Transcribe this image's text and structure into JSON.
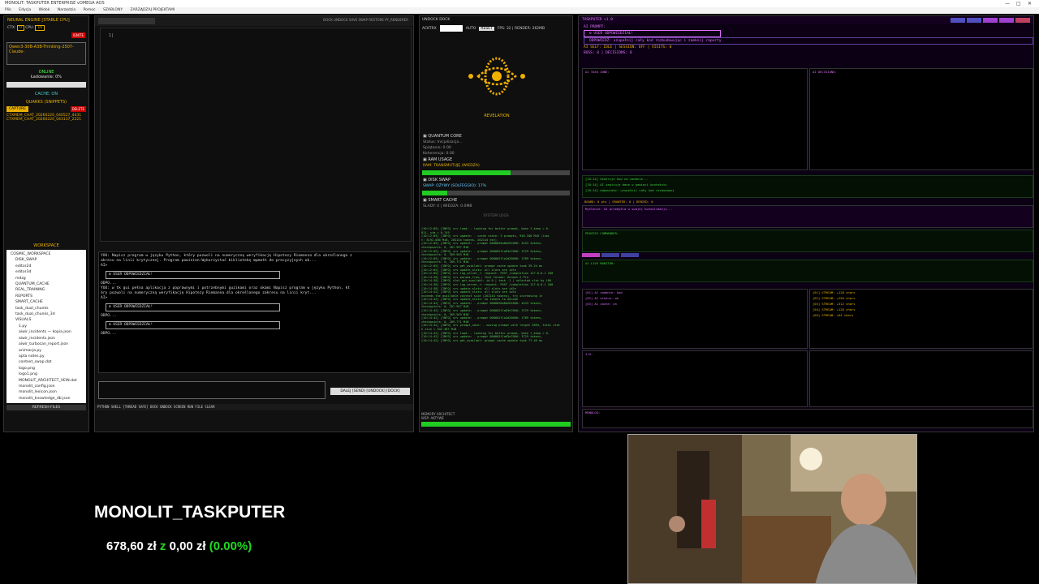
{
  "titlebar": {
    "title": "MONOLIT: TASKPUTER ENTERPRISE vOMEGA AOS"
  },
  "menubar": [
    "Plik",
    "Edycja",
    "Widok",
    "Narzędzia",
    "Pomoc",
    "SZABLONY",
    "ZARZĄDZAJ PROJEKTAMI"
  ],
  "left": {
    "engine_title": "NEURAL ENGINE [STABLE CPU]",
    "ctx_label": "CTX:",
    "ctx_value": "0",
    "cpu_label": "CPU:",
    "cpu_value": "16",
    "ignite": "IGNITE",
    "model": "Qwen3-30B-A3B-Thinking-2507-Claude-",
    "status": "ONLINE",
    "loading": "Ładowanie: 0%",
    "cache": "CACHE: ON",
    "quarks_title": "QUARKS (SNIPPETS)",
    "capture": "CAPTURE",
    "delete": "DELETE",
    "snippets": [
      "CTXMEM_CHAT_20260220_040527_4431",
      "CTXMEM_CHAT_20260220_043137_2221"
    ],
    "workspace_title": "WORKSPACE",
    "tree": [
      "COSMIC_WORKSPACE",
      "DISK_SWAP",
      "editor2d",
      "editor3d",
      "mdzg",
      "QUANTUM_CACHE",
      "REAL_TRAINING",
      "REPORTS",
      "SMART_CACHE",
      "task_dual_chunks",
      "task_dual_chunks_3d",
      "VISUALS",
      "1.py",
      "aiwir_incidents — kopia.json",
      "aiwir_incidents.json",
      "aiwir_turbocan_report.json",
      "animacja.py",
      "apta notes.py",
      "context_swap.dat",
      "logo.png",
      "logo1.png",
      "MONOLIT_ARCHITECT_VEIN.dat",
      "monolit_config.json",
      "monolit_lexicon.json",
      "monolit_knowledge_db.json"
    ],
    "refresh": "REFRESH FILES"
  },
  "editor": {
    "toolbar": "DOCK  UNDOCK  SAVE  SWAP  RESTORE  PY_RENDERER",
    "cursor": "1|",
    "chat_lines": [
      "YOU: Napisz program w języku Python, który pozwoli na numeryczną weryfikację Hipotezy Riemanna dla określonego z",
      "akresu na linii krytycznej. Program powinien:Wykorzystać bibliotekę mpmath do precyzyjnych ob...",
      "AI>",
      "YOU: w tk gui pełna aplikacja z poprawnymi i potrzebnymi guzikami oraz okami Napisz program w języku Python, kt",
      "óry pozwoli na numeryczną weryfikację Hipotezy Riemanna dla określonego zakresu na linii kryt...",
      "AI>"
    ],
    "answer_label": "⚙ USER ODPOWIEDZIAŁ!",
    "answer_sub": "ODPO...",
    "send_button": "DALEJ [SEND] [UNDOCK] [DOCK]",
    "shell": "PYTHON SHELL [THREAD SAFE]  DOCK  UNDOCK  SCREEN  RUN  FILE  CLEAR"
  },
  "monitor": {
    "dock_buttons": "UNDOCK  DOCK",
    "act_label": "ACKTRX",
    "auto": "AUTO",
    "reset": "RESET",
    "fps": "FPS: 32 | RENDER: 262MB",
    "revelation": "REVELATION",
    "quantum_title": "QUANTUM CORE",
    "q_status": "Status: Inicjalizacja...",
    "q_spl": "Splątanie: 0.00",
    "q_koh": "Koherencja: 0.00",
    "ram_title": "RAM USAGE",
    "ram_sub": "RAM: TRANSMUTUJĘ (WIEDZA)",
    "ram_fill": 0.6,
    "disk_title": "DISK SWAP",
    "disk_sub": "SWAP: OŻYWY (SOLFEGGIO): 17%",
    "disk_fill": 0.17,
    "smart_title": "SMART CACHE",
    "smart_sub": "ŚLADY: 0 | WIEDZA: 0.0MB",
    "syslog_title": "SYSTEM LOGS",
    "log_lines": [
      "[10:12:05] [INFO] srv  load: - looking for better prompt, base f_keep = 0.",
      "011, sim = 0.749",
      "[10:12:05] [INFO] srv  update: - cache state: 3 prompts, 946.348 MiB (limi",
      "t: 8192.000 MiB, 262144 tokens, 262144 est)",
      "[10:12:05] [INFO] srv  update: - prompt 0000020a8d201000: 4243 tokens,",
      "checkpoints: 0, 287.957 MiB",
      "[10:12:05] [INFO] srv  update: - prompt 000002f1a63e7000: 3729 tokens,",
      "checkpoints: 0, 369.563 MiB",
      "[10:12:05] [INFO] srv  update: - prompt 000002f1a2d20000: 1789 tokens,",
      "checkpoints: 0, 289.771 MiB",
      "[10:12:05] [INFO] srv  get_availabl: prompt cache update took 39.24 ms",
      "[10:12:05] [INFO] srv  update_slots: all slots are idle",
      "[10:12:05] [INFO] srv  log_server_r: request: POST /completion 127.0.0.1 200",
      "[10:14:38] [INFO] srv  params_from_: Chat format: Hermes 2 Pro",
      "[10:14:38] [INFO] slot get_availabl: id 0 | task -1 | selected slot by LRU",
      "[10:14:38] [INFO] srv  log_server_r: request: POST /completion 127.0.0.1 200",
      "[10:14:38] [INFO] srv  update_slots: all slots are idle",
      "[10:14:42] [INFO] srv  update_slots: all slots are idle",
      "exceeds the available context size (262144 tokens), try increasing it",
      "[10:14:42] [INFO] srv  update_slots: no tokens to decode",
      "[10:14:42] [INFO] srv  update: - prompt 0000020a8d201000: 4243 tokens,",
      "checkpoints: 0, 287.957 MiB",
      "[10:14:42] [INFO] srv  update: - prompt 000002f1a63e7000: 3729 tokens,",
      "checkpoints: 0, 369.563 MiB",
      "[10:14:42] [INFO] srv  update: - prompt 000002f1a2d20000: 1789 tokens,",
      "checkpoints: 0, 289.771 MiB",
      "[10:14:42] [INFO] srv  prompt_save: - saving prompt with length 3894, total stat",
      "e size = 342.387 MiB",
      "[10:14:42] [INFO] srv  load: - looking for better prompt, base f_keep = 0.",
      "[10:14:42] [INFO] srv  update: - prompt 000002f1a63e7000: 3729 tokens,",
      "[10:14:42] [INFO] srv  get_availabl: prompt cache update took 77.46 ms"
    ],
    "mem_arch": "MEMORY ARCHITECT",
    "mem_status": "WSP: AKTYWE"
  },
  "right": {
    "header": "TASKPUTER v1.0",
    "subline": "AI PROMPT:",
    "user_box": "⚙ USER ODPOWIEDZIAŁ!",
    "task_line": "ODPOWIEDŹ: uzupełnij cały kod rozbudowując i zamknij raporty",
    "state_line": "AI SELF: IDLE | SESSION: OFF | VISITS: 0",
    "boss_line": "BOSS: 0 | DECISIONS: 0",
    "task_desc": "AI TASK ZONE:",
    "decision_label": "AI DECISIONS:",
    "green_lines": [
      "[10:14] Generuje kod na zadanie...",
      "[10:14] AI zapisuje dane w pamięci kontekstu",
      "[10:14] odpowiedz: uzupełnij cały kod rozbudowuj"
    ],
    "magenta_line1": "BOARD: 0 pts | GRANTED: 0 | DENIED: 0",
    "magenta_line2": "Myślenie: AI przemyśla w swojej konsolidacji...",
    "crack_label": "PROCESS COMMANDER:",
    "ai_monitor": "AI LIVE MONITOR:",
    "tasks_left": [
      "[01] AI zadanie: kod",
      "[02] AI status: ok",
      "[03] AI cache: on"
    ],
    "tasks_right": [
      "[01] STREAM: +128 chars",
      "[02] STREAM: +256 chars",
      "[03] STREAM: +512 chars",
      "[04] STREAM: +128 chars",
      "[05] STREAM: +64 chars"
    ],
    "io_label": "I/O:",
    "bottom_label": "MONOLOG:"
  },
  "overlay": {
    "title": "MONOLIT_TASKPUTER",
    "amount": "678,60 zł",
    "joiner": "z",
    "goal": "0,00 zł",
    "percent": "(0.00%)"
  },
  "colors": {
    "accent": "#e8b000",
    "online": "#44ff44",
    "log_green": "#55cc55",
    "magenta": "#e070ff"
  }
}
